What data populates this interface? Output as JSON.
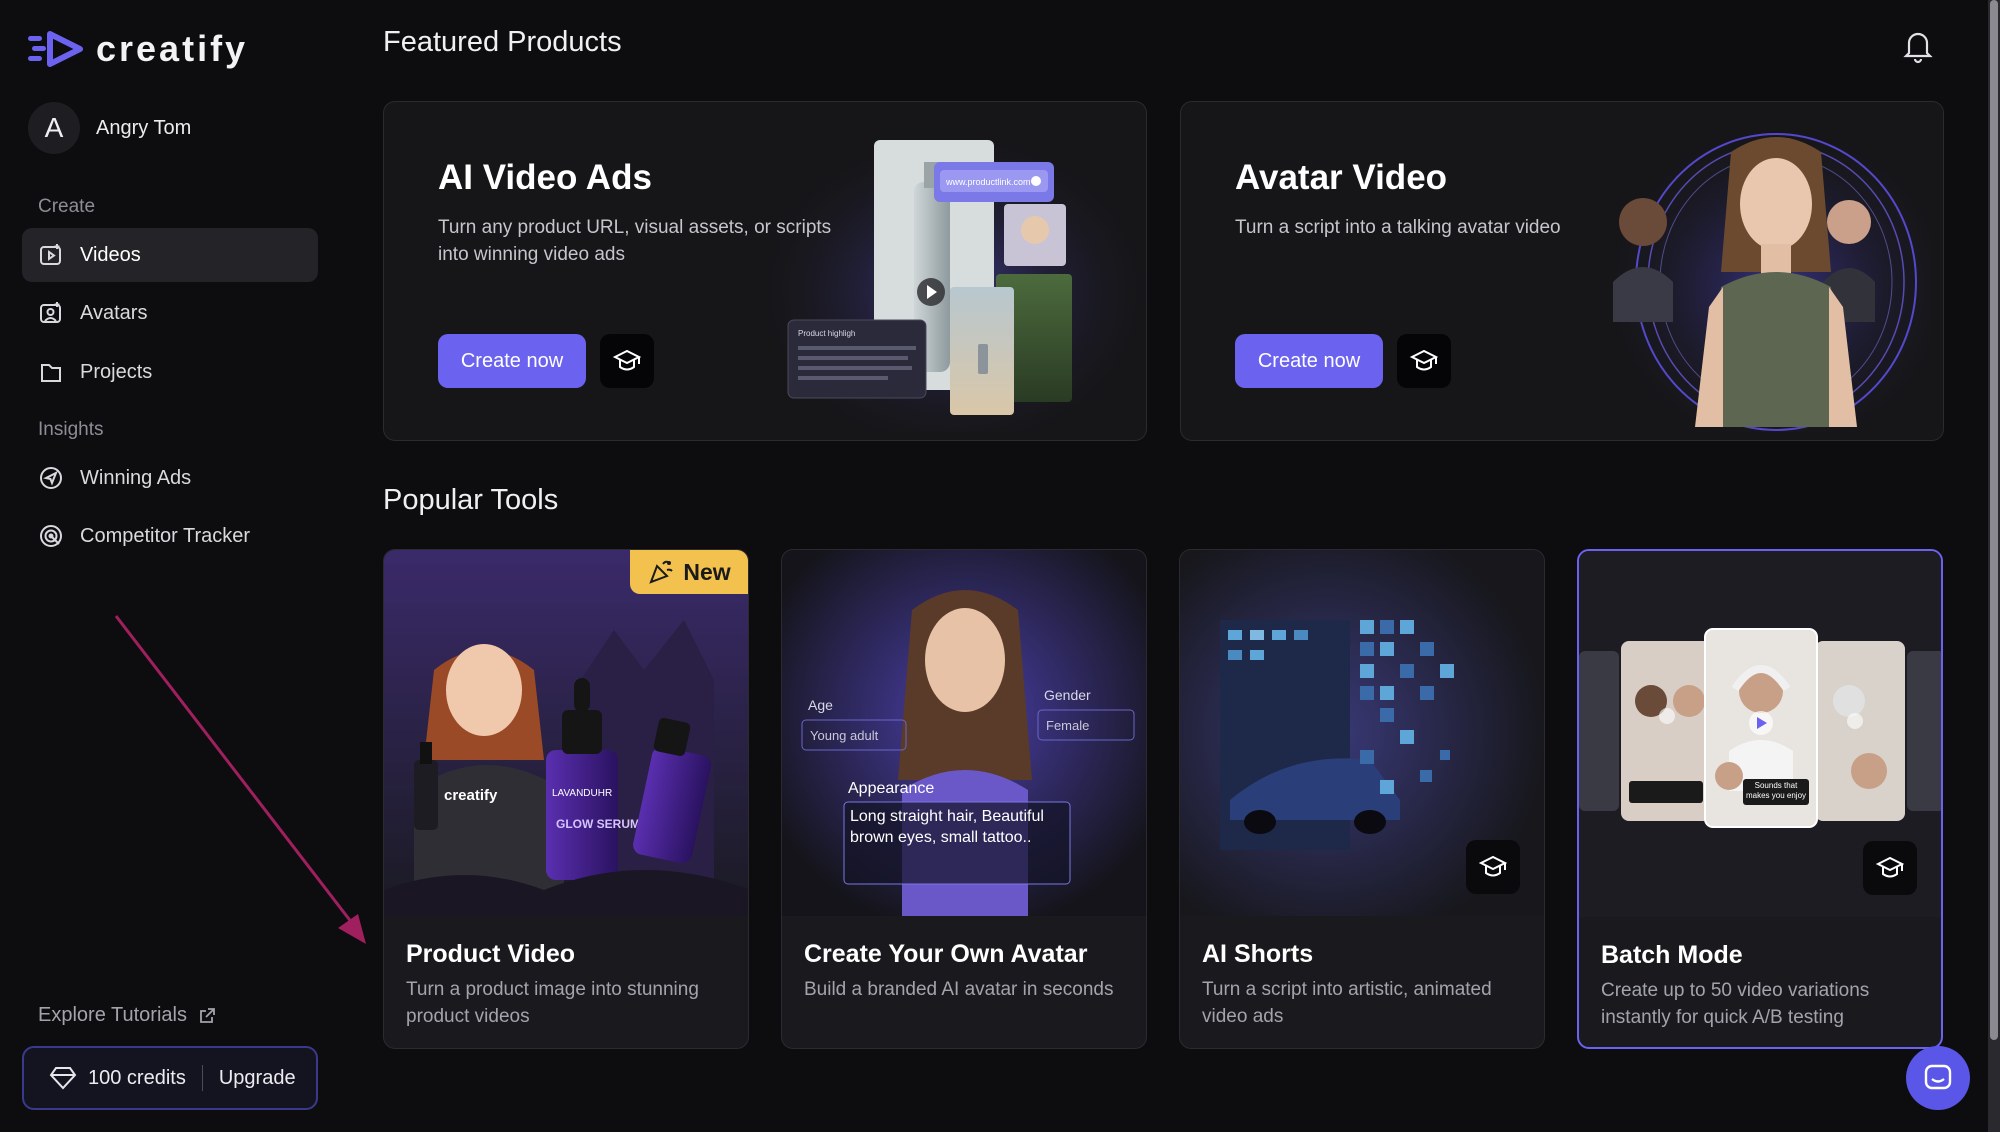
{
  "brand": {
    "name": "creatify",
    "accent": "#6b63f0"
  },
  "user": {
    "initial": "A",
    "name": "Angry Tom"
  },
  "sidebar": {
    "create_label": "Create",
    "insights_label": "Insights",
    "items": [
      {
        "label": "Videos",
        "icon": "video-icon",
        "active": true
      },
      {
        "label": "Avatars",
        "icon": "avatar-icon"
      },
      {
        "label": "Projects",
        "icon": "folder-icon"
      },
      {
        "label": "Winning Ads",
        "icon": "send-icon"
      },
      {
        "label": "Competitor Tracker",
        "icon": "radar-icon"
      }
    ],
    "explore_label": "Explore Tutorials",
    "credits_label": "100 credits",
    "upgrade_label": "Upgrade"
  },
  "featured": {
    "title": "Featured Products",
    "cards": [
      {
        "title": "AI Video Ads",
        "desc": "Turn any product URL, visual assets, or scripts into winning video ads",
        "button": "Create now",
        "overlay_url": "www.productlink.com",
        "overlay_panel": "Product highligh"
      },
      {
        "title": "Avatar Video",
        "desc": "Turn a script into a talking avatar video",
        "button": "Create now"
      }
    ]
  },
  "popular": {
    "title": "Popular Tools",
    "badge_new": "New",
    "cards": [
      {
        "title": "Product Video",
        "desc": "Turn a product image into stunning product videos",
        "product_text": "GLOW SERUM",
        "product_brand": "LAVANDUHR",
        "shirt_text": "creatify"
      },
      {
        "title": "Create Your Own Avatar",
        "desc": "Build a branded AI avatar in seconds",
        "age_label": "Age",
        "age_value": "Young adult",
        "gender_label": "Gender",
        "gender_value": "Female",
        "appearance_label": "Appearance",
        "appearance_value": "Long straight hair, Beautiful brown eyes, small tattoo.."
      },
      {
        "title": "AI Shorts",
        "desc": "Turn a script into artistic, animated video ads"
      },
      {
        "title": "Batch Mode",
        "desc": "Create up to 50 video variations instantly for quick A/B testing",
        "caption": "Sounds that makes you enjoy",
        "selected": true
      }
    ]
  }
}
